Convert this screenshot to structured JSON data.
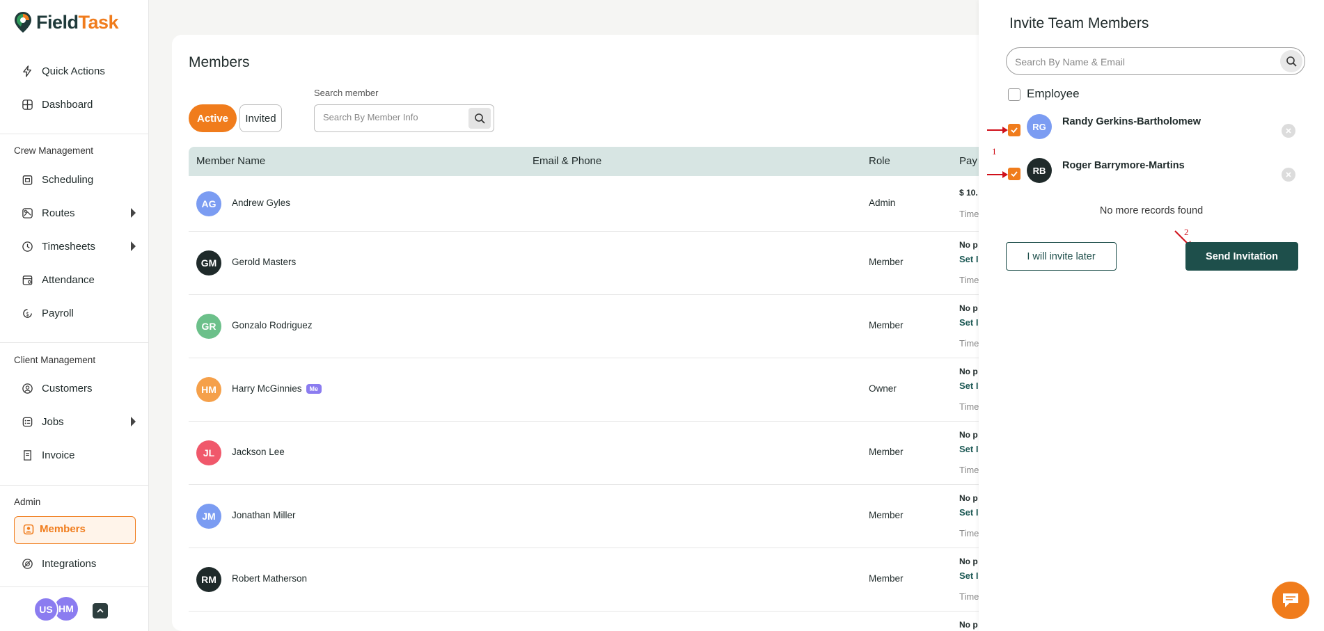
{
  "app": {
    "logo_brand": "Field",
    "logo_accent": "Task"
  },
  "sidebar": {
    "quick_actions": "Quick Actions",
    "dashboard": "Dashboard",
    "crew_section": "Crew Management",
    "scheduling": "Scheduling",
    "routes": "Routes",
    "timesheets": "Timesheets",
    "attendance": "Attendance",
    "payroll": "Payroll",
    "client_section": "Client Management",
    "customers": "Customers",
    "jobs": "Jobs",
    "invoice": "Invoice",
    "admin_section": "Admin",
    "members": "Members",
    "integrations": "Integrations",
    "user_avatars": [
      "US",
      "HM"
    ]
  },
  "main": {
    "title": "Members",
    "tabs": [
      "Active",
      "Invited"
    ],
    "search_label": "Search member",
    "search_placeholder": "Search By Member Info",
    "columns": [
      "Member Name",
      "Email & Phone",
      "Role",
      "Pay"
    ],
    "rows": [
      {
        "initials": "AG",
        "name": "Andrew Gyles",
        "me": "",
        "role": "Admin",
        "pay1": "$ 10.",
        "pay2": "",
        "pay3": "Time"
      },
      {
        "initials": "GM",
        "name": "Gerold Masters",
        "me": "",
        "role": "Member",
        "pay1": "No p",
        "pay2": "Set I",
        "pay3": "Time"
      },
      {
        "initials": "GR",
        "name": "Gonzalo Rodriguez",
        "me": "",
        "role": "Member",
        "pay1": "No p",
        "pay2": "Set I",
        "pay3": "Time"
      },
      {
        "initials": "HM",
        "name": "Harry McGinnies",
        "me": "Me",
        "role": "Owner",
        "pay1": "No p",
        "pay2": "Set I",
        "pay3": "Time"
      },
      {
        "initials": "JL",
        "name": "Jackson Lee",
        "me": "",
        "role": "Member",
        "pay1": "No p",
        "pay2": "Set I",
        "pay3": "Time"
      },
      {
        "initials": "JM",
        "name": "Jonathan Miller",
        "me": "",
        "role": "Member",
        "pay1": "No p",
        "pay2": "Set I",
        "pay3": "Time"
      },
      {
        "initials": "RM",
        "name": "Robert Matherson",
        "me": "",
        "role": "Member",
        "pay1": "No p",
        "pay2": "Set I",
        "pay3": "Time"
      },
      {
        "initials": "",
        "name": "",
        "me": "",
        "role": "",
        "pay1": "No p",
        "pay2": "",
        "pay3": ""
      }
    ]
  },
  "panel": {
    "title": "Invite Team Members",
    "search_placeholder": "Search By Name & Email",
    "employee_label": "Employee",
    "invitees": [
      {
        "initials": "RG",
        "name": "Randy Gerkins-Bartholomew",
        "checked": true
      },
      {
        "initials": "RB",
        "name": "Roger Barrymore-Martins",
        "checked": true
      }
    ],
    "no_more": "No more records found",
    "later_button": "I will invite later",
    "send_button": "Send Invitation",
    "annotation_1": "1",
    "annotation_2": "2"
  },
  "colors": {
    "accent": "#f07c1c",
    "primary_dark": "#1e4f4b",
    "table_header": "#d7e5e3"
  }
}
